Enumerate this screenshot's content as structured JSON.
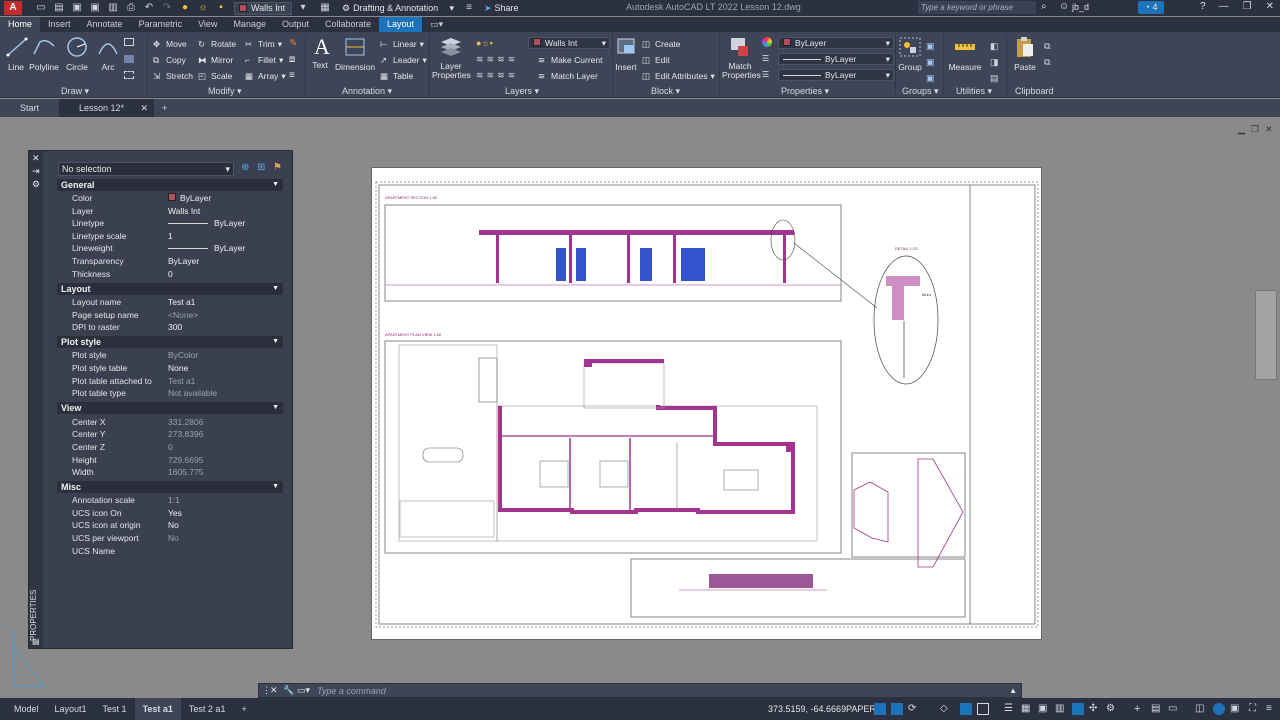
{
  "titlebar": {
    "workspace": "Drafting & Annotation",
    "layer_combo": "Walls Int",
    "share": "Share",
    "title": "Autodesk AutoCAD LT 2022    Lesson 12.dwg",
    "search_placeholder": "Type a keyword or phrase",
    "user": "jb_d",
    "notif_count": "4"
  },
  "ribbon_tabs": [
    "Home",
    "Insert",
    "Annotate",
    "Parametric",
    "View",
    "Manage",
    "Output",
    "Collaborate",
    "Layout"
  ],
  "ribbon": {
    "draw": {
      "line": "Line",
      "polyline": "Polyline",
      "circle": "Circle",
      "arc": "Arc",
      "label": "Draw"
    },
    "modify": {
      "move": "Move",
      "rotate": "Rotate",
      "trim": "Trim",
      "copy": "Copy",
      "mirror": "Mirror",
      "fillet": "Fillet",
      "stretch": "Stretch",
      "scale": "Scale",
      "array": "Array",
      "label": "Modify"
    },
    "annotation": {
      "text": "Text",
      "dimension": "Dimension",
      "linear": "Linear",
      "leader": "Leader",
      "table": "Table",
      "label": "Annotation"
    },
    "layers": {
      "layer_properties": "Layer Properties",
      "current_layer": "Walls Int",
      "make_current": "Make Current",
      "match_layer": "Match Layer",
      "label": "Layers"
    },
    "block": {
      "insert": "Insert",
      "create": "Create",
      "edit": "Edit",
      "edit_attributes": "Edit Attributes",
      "label": "Block"
    },
    "properties": {
      "match": "Match Properties",
      "color": "ByLayer",
      "linetype": "ByLayer",
      "lineweight": "ByLayer",
      "label": "Properties"
    },
    "groups": {
      "group": "Group",
      "label": "Groups"
    },
    "utilities": {
      "measure": "Measure",
      "label": "Utilities"
    },
    "clipboard": {
      "paste": "Paste",
      "label": "Clipboard"
    }
  },
  "file_tabs": [
    "Start",
    "Lesson 12*"
  ],
  "properties_palette": {
    "selection": "No selection",
    "title": "PROPERTIES",
    "sections": {
      "general": "General",
      "layout": "Layout",
      "plot_style": "Plot style",
      "view": "View",
      "misc": "Misc"
    },
    "general": [
      {
        "k": "Color",
        "v": "ByLayer"
      },
      {
        "k": "Layer",
        "v": "Walls Int"
      },
      {
        "k": "Linetype",
        "v": "ByLayer"
      },
      {
        "k": "Linetype scale",
        "v": "1"
      },
      {
        "k": "Lineweight",
        "v": "ByLayer"
      },
      {
        "k": "Transparency",
        "v": "ByLayer"
      },
      {
        "k": "Thickness",
        "v": "0"
      }
    ],
    "layout": [
      {
        "k": "Layout name",
        "v": "Test a1"
      },
      {
        "k": "Page setup name",
        "v": "<None>"
      },
      {
        "k": "DPI to raster",
        "v": "300"
      }
    ],
    "plot_style": [
      {
        "k": "Plot style",
        "v": "ByColor"
      },
      {
        "k": "Plot style table",
        "v": "None"
      },
      {
        "k": "Plot table attached to",
        "v": "Test a1"
      },
      {
        "k": "Plot table type",
        "v": "Not available"
      }
    ],
    "view": [
      {
        "k": "Center X",
        "v": "331.2806"
      },
      {
        "k": "Center Y",
        "v": "273.8396"
      },
      {
        "k": "Center Z",
        "v": "0"
      },
      {
        "k": "Height",
        "v": "729.6695"
      },
      {
        "k": "Width",
        "v": "1605.775"
      }
    ],
    "misc": [
      {
        "k": "Annotation scale",
        "v": "1:1"
      },
      {
        "k": "UCS icon On",
        "v": "Yes"
      },
      {
        "k": "UCS icon at origin",
        "v": "No"
      },
      {
        "k": "UCS per viewport",
        "v": "No"
      },
      {
        "k": "UCS Name",
        "v": ""
      }
    ]
  },
  "drawing": {
    "section_title": "APARTMENT SECTION 1:50",
    "plan_title": "APARTMENT PLAN VIEW 1:50",
    "detail_title": "DETAIL 1:20",
    "detail_label": "Muro"
  },
  "command_line": {
    "placeholder": "Type a command"
  },
  "status_tabs": [
    "Model",
    "Layout1",
    "Test 1",
    "Test a1",
    "Test 2 a1"
  ],
  "status": {
    "coords": "373.5159, -64.6669",
    "space": "PAPER"
  },
  "colors": {
    "magenta": "#a2338f",
    "accent": "#1c73b9",
    "ui_dark": "#2b3140",
    "ui_mid": "#3e4557"
  }
}
